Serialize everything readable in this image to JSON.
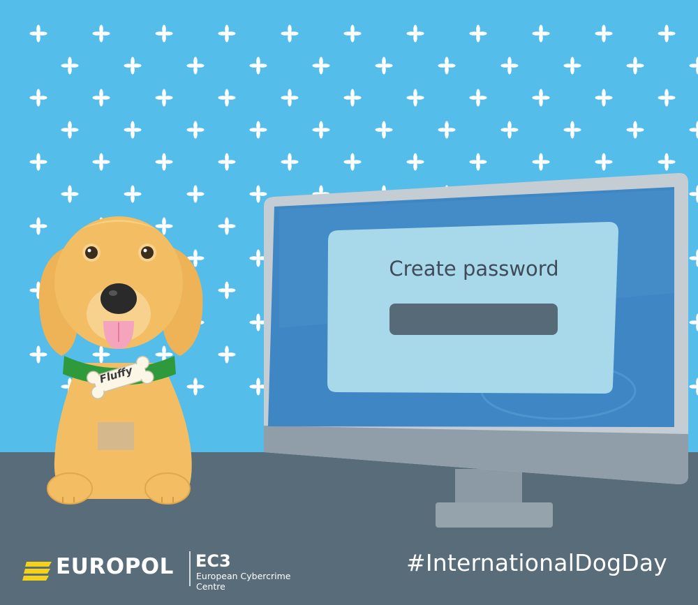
{
  "hashtag": "#InternationalDogDay",
  "org": {
    "name": "EUROPOL",
    "unit": "EC3",
    "unit_full": "European Cybercrime Centre"
  },
  "dialog": {
    "title": "Create password",
    "password_value": ""
  },
  "dog": {
    "tag_name": "Fluffy"
  },
  "colors": {
    "wallpaper": "#55bde9",
    "desk": "#586c7a",
    "monitor_frame": "#c3cdd3",
    "screen": "#3f87c4",
    "dialog_bg": "#a8d9ea",
    "password_field": "#576a78",
    "dog_fur": "#f2bd63",
    "collar": "#2f9a3c",
    "brand_yellow": "#f4d21a"
  }
}
